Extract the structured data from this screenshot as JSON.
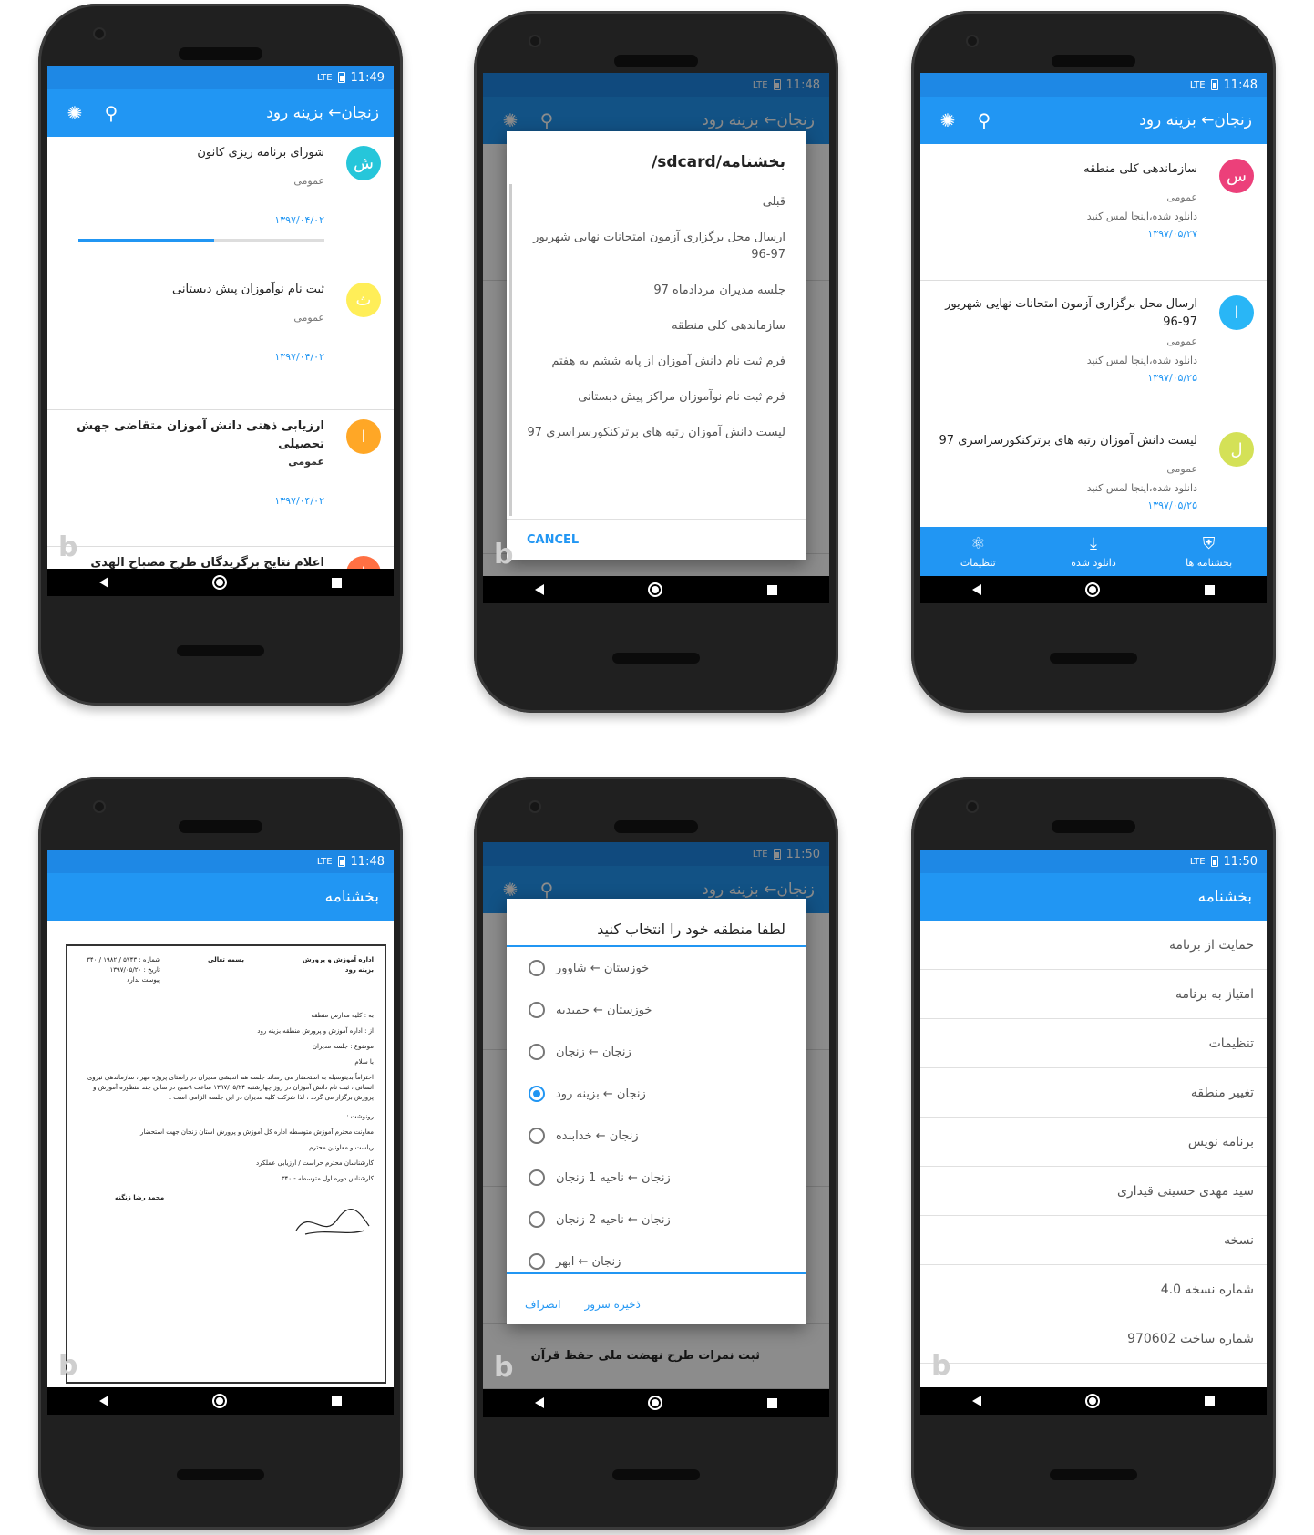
{
  "colors": {
    "primary": "#2196f3",
    "status": "#1e88e5",
    "accent_teal": "#26c6da",
    "accent_yellow": "#ffee58",
    "accent_orange": "#ffa726",
    "accent_deeporange": "#ff7043",
    "accent_pink": "#ec407a",
    "accent_blue": "#29b6f6",
    "accent_lime": "#d4e157"
  },
  "common": {
    "app_title": "زنجان← بزینه رود",
    "network": "LTE"
  },
  "p1": {
    "time": "11:49",
    "items": [
      {
        "avatar": "ش",
        "title": "شورای برنامه ریزی کانون",
        "category": "عمومی",
        "date": "۱۳۹۷/۰۴/۰۲",
        "progress": 0.55
      },
      {
        "avatar": "ث",
        "title": "ثبت نام نوآموزان پیش دبستانی",
        "category": "عمومی",
        "date": "۱۳۹۷/۰۴/۰۲"
      },
      {
        "avatar": "ا",
        "title": "ارزیابی ذهنی دانش آموزان متقاضی جهش تحصیلی",
        "category": "عمومی",
        "date": "۱۳۹۷/۰۴/۰۲"
      },
      {
        "avatar": "ا",
        "title": "اعلام نتایج برگزیدگان طرح مصباح الهدی"
      }
    ]
  },
  "p2": {
    "time": "11:48",
    "dialog_title": "بخشنامه/sdcard/",
    "items": [
      "قبلی",
      "ارسال محل برگزاری آزمون امتحانات نهایی شهریور 97-96",
      "جلسه مدیران مردادماه 97",
      "سازماندهی کلی منطقه",
      "فرم ثبت نام دانش آموزان از پایه ششم به هفتم",
      "فرم ثبت نام نوآموزان مراکز پیش دبستانی",
      "لیست دانش آموزان رتبه های برترکنکورسراسری 97"
    ],
    "cancel": "CANCEL"
  },
  "p3": {
    "time": "11:48",
    "items": [
      {
        "avatar": "س",
        "title": "سازماندهی کلی منطقه",
        "category": "عمومی",
        "status": "دانلود شده،اینجا لمس کنید",
        "date": "۱۳۹۷/۰۵/۲۷"
      },
      {
        "avatar": "ا",
        "title": "ارسال محل برگزاری آزمون امتحانات نهایی شهریور 97-96",
        "category": "عمومی",
        "status": "دانلود شده،اینجا لمس کنید",
        "date": "۱۳۹۷/۰۵/۲۵"
      },
      {
        "avatar": "ل",
        "title": "لیست دانش آموزان رتبه های برترکنکورسراسری 97",
        "category": "عمومی",
        "status": "دانلود شده،اینجا لمس کنید",
        "date": "۱۳۹۷/۰۵/۲۵"
      }
    ],
    "nav": {
      "circulars": "بخشنامه ها",
      "downloaded": "دانلود شده",
      "settings": "تنظیمات"
    }
  },
  "p4": {
    "time": "11:48",
    "title": "بخشنامه",
    "doc": {
      "heading": "بسمه تعالی",
      "org": "اداره آموزش و پرورش بزینه رود",
      "meta_number": "شماره : ۵۷۴۳ / ۱۹۸۲ / ۳۴۰",
      "meta_date": "تاریخ : ۱۳۹۷/۰۵/۲۰",
      "meta_attach": "پیوست ندارد",
      "to": "به : کلیه مدارس منطقه",
      "from": "از : اداره آموزش و پرورش منطقه بزینه رود",
      "subject": "موضوع : جلسه مدیران",
      "greeting": "با سلام",
      "body": "احتراماً بدینوسیله به استحضار می رساند جلسه هم اندیشی مدیران در راستای پروژه مهر ، سازماندهی نیروی انسانی ، ثبت نام دانش آموزان در روز چهارشنبه ۱۳۹۷/۰۵/۲۴ ساعت ۹صبح در سالن چند منظوره آموزش و پرورش برگزار می گردد ، لذا شرکت کلیه مدیران در این جلسه الزامی است .",
      "cc": "رونوشت :",
      "cc1": "معاونت محترم آموزش متوسطه اداره کل آموزش و پرورش استان زنجان جهت استحضار",
      "cc2": "ریاست و معاونین محترم",
      "cc3": "کارشناسان محترم حراست / ارزیابی عملکرد",
      "cc4": "کارشناس دوره اول متوسطه - ۳۴۰",
      "signer": "محمد رضا زنگنه"
    }
  },
  "p5": {
    "time": "11:50",
    "dialog_title": "لطفا منطقه خود را انتخاب کنید",
    "options": [
      "خوزستان ← شاوور",
      "خوزستان ← جمیدیه",
      "زنجان ← زنجان",
      "زنجان ← بزینه رود",
      "زنجان ← خدابنده",
      "زنجان ← ناحیه 1 زنجان",
      "زنجان ← ناحیه 2 زنجان",
      "زنجان ← ابهر"
    ],
    "selected_index": 3,
    "save": "ذخیره سرور",
    "cancel": "انصراف",
    "behind_item": "ثبت نمرات طرح نهضت ملی حفظ قرآن"
  },
  "p6": {
    "time": "11:50",
    "title": "بخشنامه",
    "menu": [
      "حمایت از برنامه",
      "امتیاز به برنامه",
      "تنظیمات",
      "تغییر منطقه",
      "برنامه نویس",
      "سید مهدی حسینی قیداری",
      "نسخه",
      "شماره نسخه 4.0",
      "شماره ساخت 970602"
    ]
  }
}
